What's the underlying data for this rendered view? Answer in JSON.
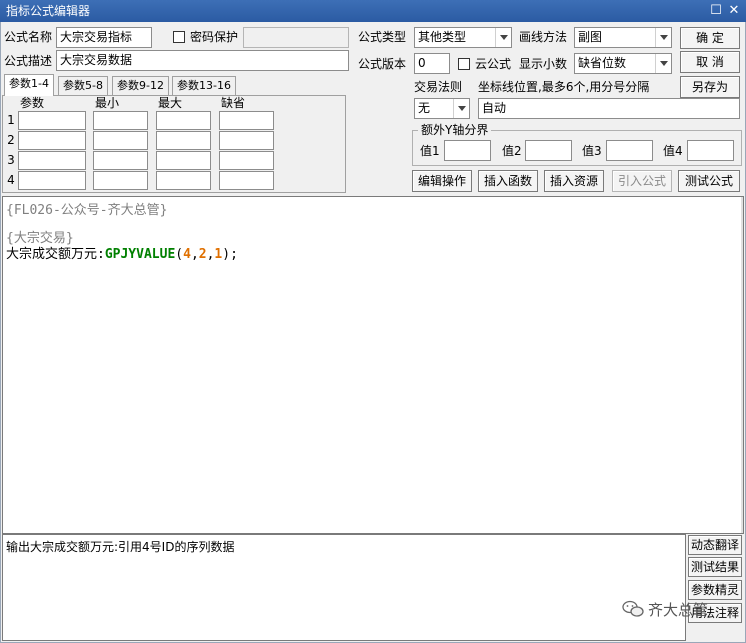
{
  "window": {
    "title": "指标公式编辑器",
    "maximize_glyph": "☐",
    "close_glyph": "✕"
  },
  "form": {
    "name_label": "公式名称",
    "name_value": "大宗交易指标",
    "password_label": "密码保护",
    "password_value": "",
    "desc_label": "公式描述",
    "desc_value": "大宗交易数据",
    "type_label": "公式类型",
    "type_value": "其他类型",
    "draw_label": "画线方法",
    "draw_value": "副图",
    "version_label": "公式版本",
    "version_value": "0",
    "cloud_label": "云公式",
    "decimal_label": "显示小数",
    "decimal_value": "缺省位数",
    "trade_rule_label": "交易法则",
    "trade_rule_value": "无",
    "coord_label": "坐标线位置,最多6个,用分号分隔",
    "coord_value": "自动",
    "extra_y_label": "额外Y轴分界",
    "y_labels": [
      "值1",
      "值2",
      "值3",
      "值4"
    ]
  },
  "buttons": {
    "ok": "确  定",
    "cancel": "取  消",
    "save_as": "另存为",
    "edit_ops": "编辑操作",
    "insert_func": "插入函数",
    "insert_res": "插入资源",
    "import_formula": "引入公式",
    "test_formula": "测试公式"
  },
  "tabs": [
    "参数1-4",
    "参数5-8",
    "参数9-12",
    "参数13-16"
  ],
  "params": {
    "headers": [
      "参数",
      "最小",
      "最大",
      "缺省"
    ],
    "rows": [
      "1",
      "2",
      "3",
      "4"
    ]
  },
  "editor": {
    "line1": "{FL026-公众号-齐大总管}",
    "line2": "{大宗交易}",
    "line3_var": "大宗成交额万元:",
    "line3_func": "GPJYVALUE",
    "line3_open": "(",
    "line3_a1": "4",
    "line3_c1": ",",
    "line3_a2": "2",
    "line3_c2": ",",
    "line3_a3": "1",
    "line3_close": ");"
  },
  "output": {
    "text": "输出大宗成交额万元:引用4号ID的序列数据"
  },
  "side_buttons": [
    "动态翻译",
    "测试结果",
    "参数精灵",
    "用法注释"
  ],
  "watermark": "齐大总管"
}
